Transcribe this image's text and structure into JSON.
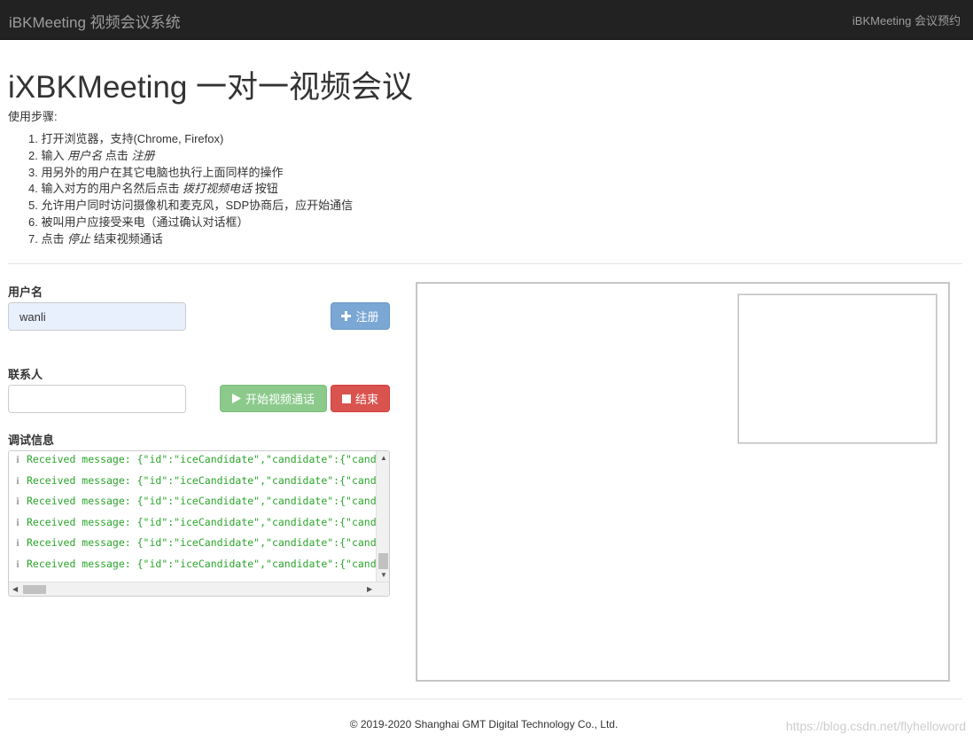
{
  "navbar": {
    "brand": "iBKMeeting 视频会议系统",
    "right_link": "iBKMeeting 会议预约"
  },
  "main": {
    "title": "iXBKMeeting 一对一视频会议",
    "steps_title": "使用步骤:",
    "steps": [
      {
        "prefix": "1. 打开浏览器，支持(Chrome, Firefox)"
      },
      {
        "prefix": "2. 输入 ",
        "em": "用户名",
        "mid": " 点击 ",
        "em2": "注册"
      },
      {
        "prefix": "3. 用另外的用户在其它电脑也执行上面同样的操作"
      },
      {
        "prefix": "4. 输入对方的用户名然后点击 ",
        "em": "拨打视频电话",
        "suffix": " 按钮"
      },
      {
        "prefix": "5. 允许用户同时访问摄像机和麦克风，SDP协商后，应开始通信"
      },
      {
        "prefix": "6. 被叫用户应接受来电（通过确认对话框）"
      },
      {
        "prefix": "7. 点击 ",
        "em": "停止",
        "suffix": " 结束视频通话"
      }
    ]
  },
  "form": {
    "username_label": "用户名",
    "username_value": "wanli",
    "register_label": "注册",
    "contact_label": "联系人",
    "contact_value": "",
    "call_label": "开始视频通话",
    "stop_label": "结束",
    "debug_label": "调试信息"
  },
  "console": {
    "lines": [
      "Received message: {\"id\":\"iceCandidate\",\"candidate\":{\"candidate",
      "Received message: {\"id\":\"iceCandidate\",\"candidate\":{\"candidate",
      "Received message: {\"id\":\"iceCandidate\",\"candidate\":{\"candidate",
      "Received message: {\"id\":\"iceCandidate\",\"candidate\":{\"candidate",
      "Received message: {\"id\":\"iceCandidate\",\"candidate\":{\"candidate",
      "Received message: {\"id\":\"iceCandidate\",\"candidate\":{\"candidate"
    ]
  },
  "footer": {
    "copyright": "© 2019-2020 Shanghai GMT Digital Technology Co., Ltd.",
    "watermark": "https://blog.csdn.net/flyhelloword"
  },
  "colors": {
    "navbar_bg": "#222222",
    "primary": "#7ba7d4",
    "success": "#8cca8c",
    "danger": "#d9534f",
    "console_text": "#2aa52a"
  }
}
